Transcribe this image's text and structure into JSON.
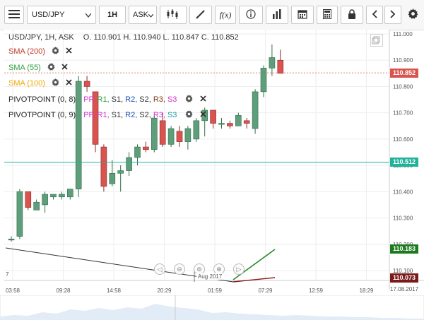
{
  "toolbar": {
    "symbol": "USD/JPY",
    "timeframe": "1H",
    "side": "ASK",
    "icons": [
      "menu-icon",
      "candles-icon",
      "draw-icon",
      "function-icon",
      "info-icon",
      "bar-chart-icon",
      "calendar-icon",
      "calculator-icon",
      "lock-icon",
      "chevron-left-icon",
      "chevron-right-icon",
      "settings-icon"
    ],
    "fx_label": "f(x)"
  },
  "header": {
    "info": "USD/JPY, 1H, ASK",
    "ohlc": "O. 110.901 H. 110.940 L. 110.847 C. 110.852"
  },
  "indicators": [
    {
      "label": "SMA (200)",
      "color": "#c0392b"
    },
    {
      "label": "SMA (55)",
      "color": "#2e9e3e"
    },
    {
      "label": "SMA (100)",
      "color": "#f0a800"
    },
    {
      "label": "PIVOTPOINT (0, 8)",
      "color": "#222222"
    },
    {
      "label": "PIVOTPOINT (0, 9)",
      "color": "#222222"
    }
  ],
  "pivot_rows": [
    [
      {
        "t": "PP,",
        "c": "#cc33cc"
      },
      {
        "t": "R1,",
        "c": "#2e9e3e"
      },
      {
        "t": "S1,",
        "c": "#333333"
      },
      {
        "t": "R2,",
        "c": "#1a4fb8"
      },
      {
        "t": "S2,",
        "c": "#333333"
      },
      {
        "t": "R3,",
        "c": "#7a3a1a"
      },
      {
        "t": "S3",
        "c": "#cc33cc"
      }
    ],
    [
      {
        "t": "PP,",
        "c": "#cc33cc"
      },
      {
        "t": "R1,",
        "c": "#cc33cc"
      },
      {
        "t": "S1,",
        "c": "#333333"
      },
      {
        "t": "R2,",
        "c": "#1a4fb8"
      },
      {
        "t": "S2,",
        "c": "#333333"
      },
      {
        "t": "R3,",
        "c": "#cc33cc"
      },
      {
        "t": "S3",
        "c": "#1a9aa8"
      }
    ]
  ],
  "price_axis": [
    "111.000",
    "110.900",
    "110.800",
    "110.700",
    "110.600",
    "110.500",
    "110.400",
    "110.300",
    "110.200",
    "110.100"
  ],
  "price_markers": [
    {
      "value": "110.852",
      "color": "#d9534f",
      "price": 110.852
    },
    {
      "value": "110.512",
      "color": "#20b39a",
      "price": 110.512
    },
    {
      "value": "110.183",
      "color": "#1e7a1e",
      "price": 110.183
    },
    {
      "value": "110.073",
      "color": "#7a1a1a",
      "price": 110.073
    }
  ],
  "time_axis": [
    "03:58",
    "09:28",
    "14:58",
    "20:29",
    "01:59",
    "07:29",
    "12:59",
    "18:29"
  ],
  "date_label": "17.08.2017",
  "nav_date": "Aug 2017",
  "edge_left_label": "7",
  "candles": [
    {
      "o": 110.22,
      "h": 110.23,
      "l": 110.21,
      "c": 110.22
    },
    {
      "o": 110.23,
      "h": 110.41,
      "l": 110.22,
      "c": 110.4
    },
    {
      "o": 110.4,
      "h": 110.38,
      "l": 110.33,
      "c": 110.34
    },
    {
      "o": 110.33,
      "h": 110.37,
      "l": 110.33,
      "c": 110.36
    },
    {
      "o": 110.35,
      "h": 110.4,
      "l": 110.32,
      "c": 110.39
    },
    {
      "o": 110.38,
      "h": 110.39,
      "l": 110.37,
      "c": 110.39
    },
    {
      "o": 110.38,
      "h": 110.4,
      "l": 110.37,
      "c": 110.39
    },
    {
      "o": 110.38,
      "h": 110.41,
      "l": 110.37,
      "c": 110.41
    },
    {
      "o": 110.41,
      "h": 110.84,
      "l": 110.38,
      "c": 110.82
    },
    {
      "o": 110.82,
      "h": 110.84,
      "l": 110.78,
      "c": 110.8
    },
    {
      "o": 110.78,
      "h": 110.76,
      "l": 110.55,
      "c": 110.58
    },
    {
      "o": 110.57,
      "h": 110.58,
      "l": 110.4,
      "c": 110.42
    },
    {
      "o": 110.43,
      "h": 110.52,
      "l": 110.42,
      "c": 110.47
    },
    {
      "o": 110.47,
      "h": 110.5,
      "l": 110.4,
      "c": 110.48
    },
    {
      "o": 110.48,
      "h": 110.55,
      "l": 110.46,
      "c": 110.53
    },
    {
      "o": 110.53,
      "h": 110.58,
      "l": 110.5,
      "c": 110.57
    },
    {
      "o": 110.57,
      "h": 110.59,
      "l": 110.55,
      "c": 110.56
    },
    {
      "o": 110.56,
      "h": 110.69,
      "l": 110.55,
      "c": 110.68
    },
    {
      "o": 110.67,
      "h": 110.7,
      "l": 110.57,
      "c": 110.58
    },
    {
      "o": 110.58,
      "h": 110.65,
      "l": 110.57,
      "c": 110.64
    },
    {
      "o": 110.63,
      "h": 110.65,
      "l": 110.57,
      "c": 110.59
    },
    {
      "o": 110.59,
      "h": 110.65,
      "l": 110.56,
      "c": 110.64
    },
    {
      "o": 110.6,
      "h": 110.68,
      "l": 110.59,
      "c": 110.67
    },
    {
      "o": 110.67,
      "h": 110.72,
      "l": 110.61,
      "c": 110.71
    },
    {
      "o": 110.71,
      "h": 110.69,
      "l": 110.64,
      "c": 110.66
    },
    {
      "o": 110.66,
      "h": 110.68,
      "l": 110.64,
      "c": 110.66
    },
    {
      "o": 110.66,
      "h": 110.67,
      "l": 110.64,
      "c": 110.65
    },
    {
      "o": 110.65,
      "h": 110.7,
      "l": 110.65,
      "c": 110.69
    },
    {
      "o": 110.67,
      "h": 110.68,
      "l": 110.64,
      "c": 110.66
    },
    {
      "o": 110.64,
      "h": 110.79,
      "l": 110.62,
      "c": 110.78
    },
    {
      "o": 110.78,
      "h": 110.88,
      "l": 110.76,
      "c": 110.87
    },
    {
      "o": 110.87,
      "h": 110.96,
      "l": 110.84,
      "c": 110.91
    },
    {
      "o": 110.9,
      "h": 110.94,
      "l": 110.85,
      "c": 110.85
    }
  ]
}
